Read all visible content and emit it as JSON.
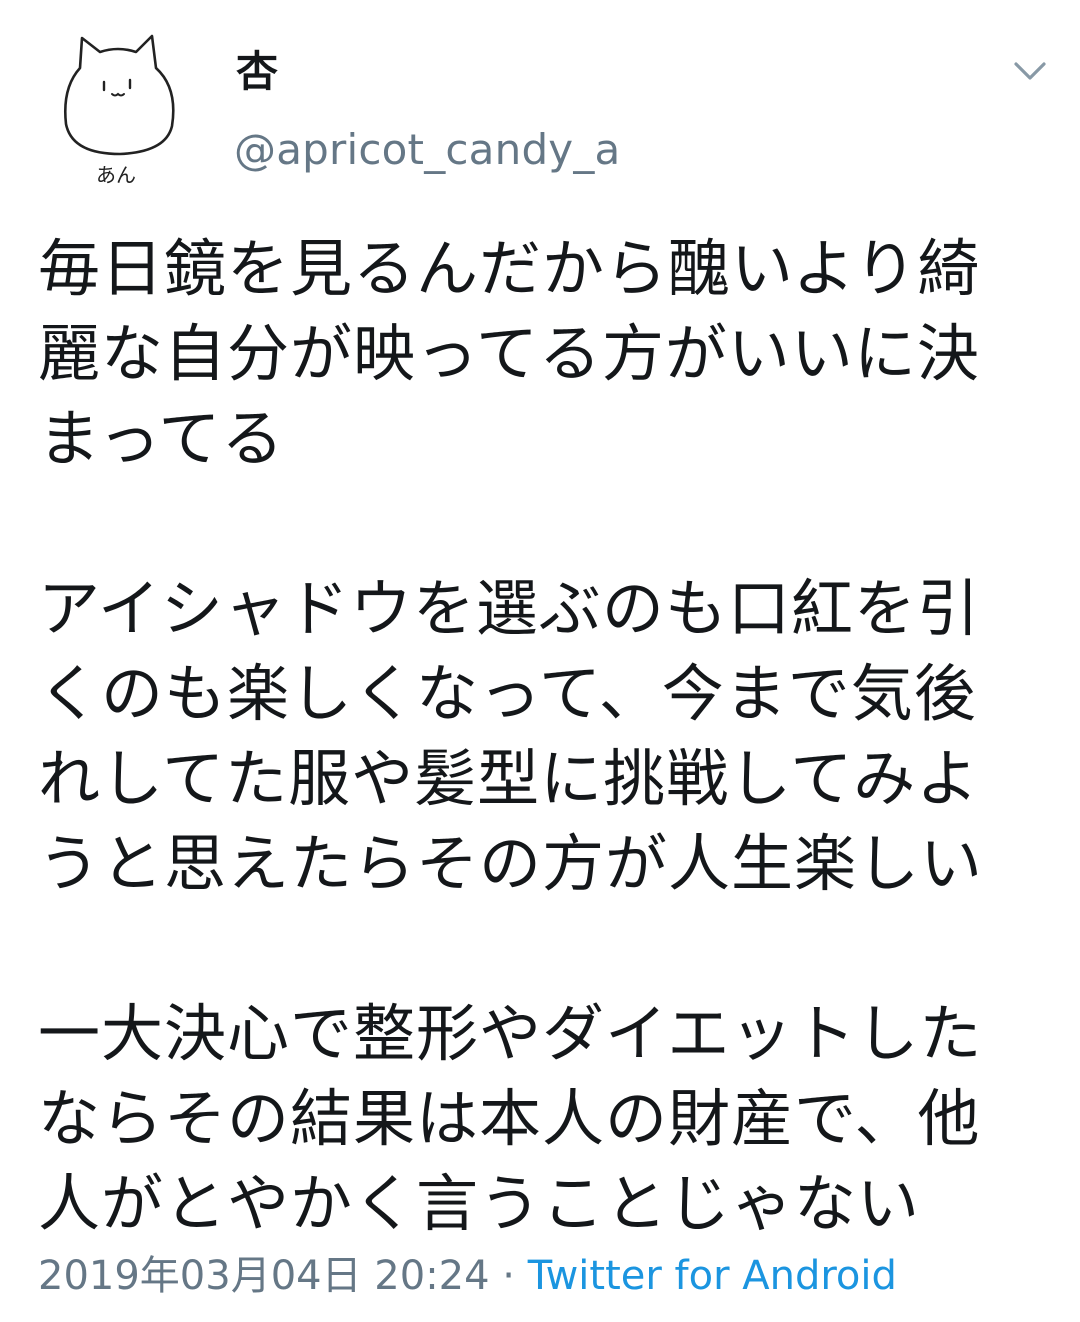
{
  "tweet": {
    "avatar": {
      "icon": "cat-doodle-avatar",
      "caption": "あん"
    },
    "name": "杏",
    "handle": "@apricot_candy_a",
    "menu_icon": "chevron-down-icon",
    "paragraphs": [
      "毎日鏡を見るんだから醜いより綺\n麗な自分が映ってる方がいいに決\nまってる",
      "アイシャドウを選ぶのも口紅を引\nくのも楽しくなって、今まで気後\nれしてた服や髪型に挑戦してみよ\nうと思えたらその方が人生楽しい",
      "一大決心で整形やダイエットした\nならその結果は本人の財産で、他\n人がとやかく言うことじゃない"
    ],
    "timestamp": "2019年03月04日 20:24",
    "separator": " · ",
    "source": "Twitter for Android"
  },
  "colors": {
    "text": "#14171a",
    "secondary": "#657786",
    "link": "#1b95e0"
  }
}
